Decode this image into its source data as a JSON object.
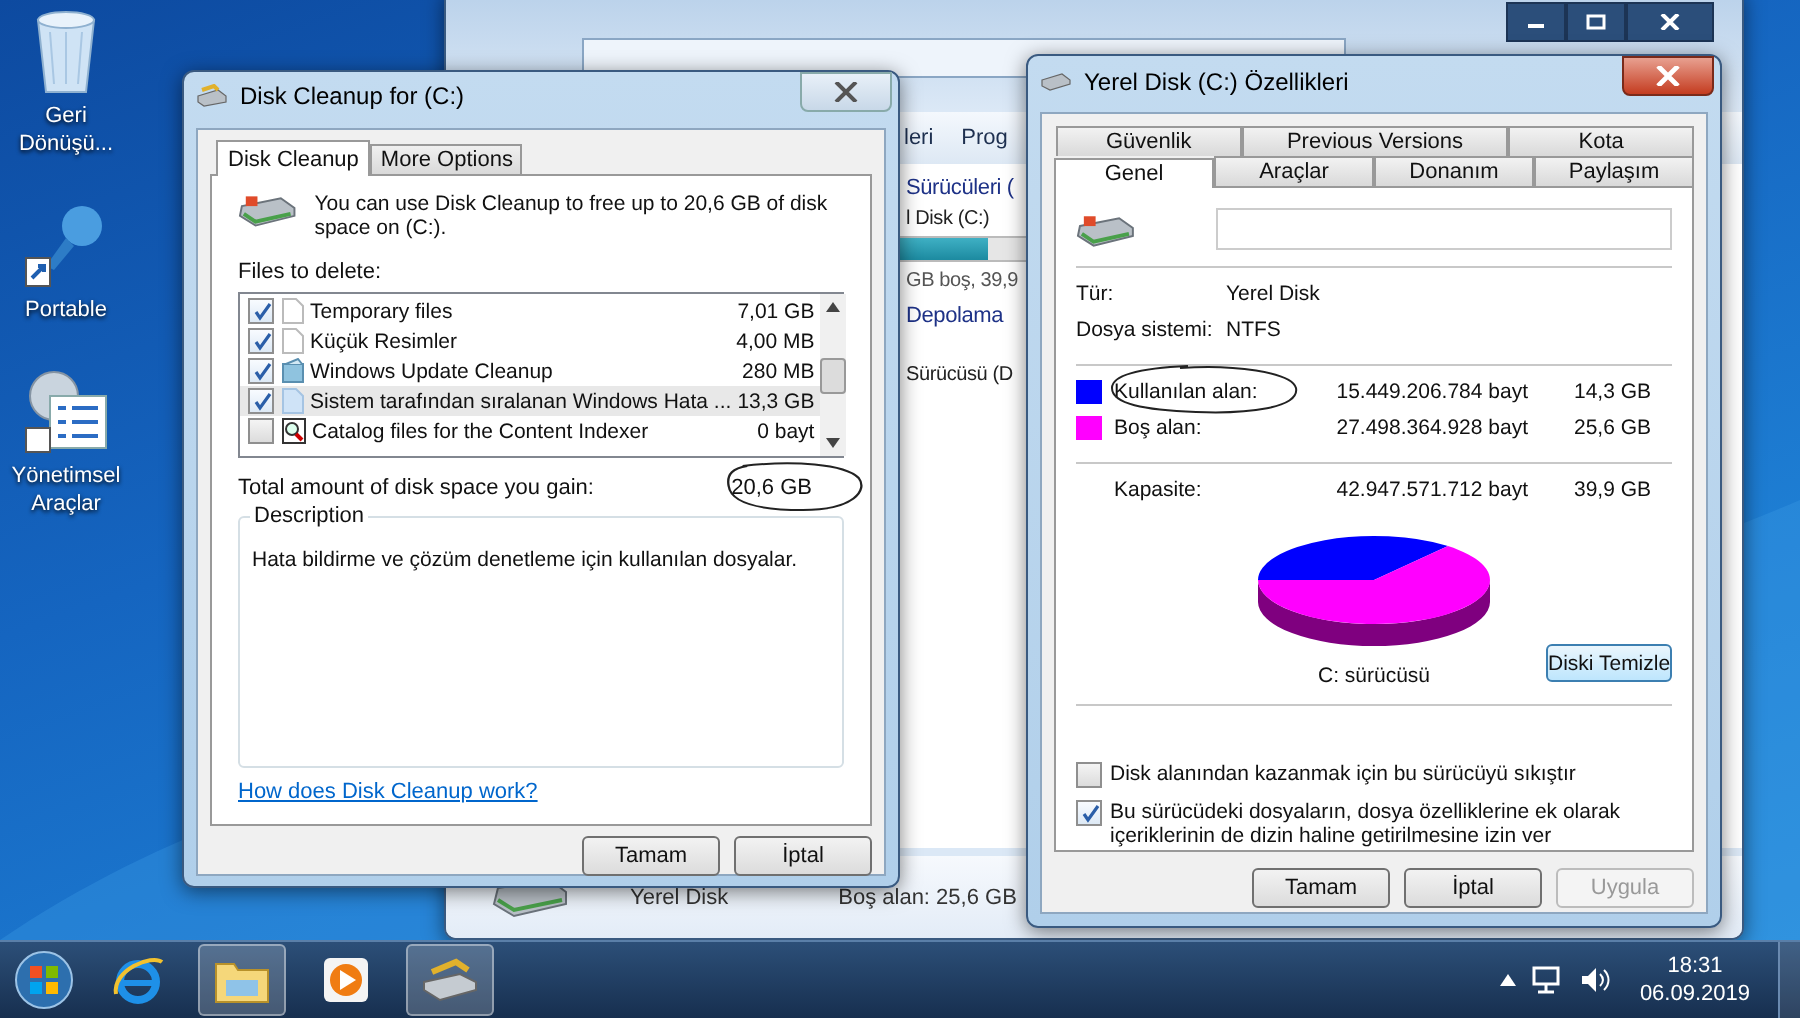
{
  "desktop_icons": [
    {
      "kind": "recycle-bin",
      "label": "Geri Dönüşü..."
    },
    {
      "kind": "pin",
      "label": "Portable"
    },
    {
      "kind": "tools",
      "label": "Yönetimsel Araçlar"
    }
  ],
  "explorer": {
    "toolbar": [
      "leri",
      "Prog"
    ],
    "heading": "Sürücüleri (",
    "drive": "l Disk (C:)",
    "drive_bar": {
      "level": 0.36
    },
    "free_text": "GB boş, 39,9",
    "section": "Depolama",
    "drive2": "Sürücüsü (D",
    "details": {
      "name": "Yerel Disk",
      "free": "Boş alan: 25,6 GB"
    }
  },
  "disk_cleanup": {
    "title": "Disk Cleanup for  (C:)",
    "tabs": [
      {
        "label": "Disk Cleanup",
        "selected": true
      },
      {
        "label": "More Options",
        "selected": false
      }
    ],
    "intro": "You can use Disk Cleanup to free up to 20,6 GB of disk space on (C:).",
    "files_label": "Files to delete:",
    "files": [
      {
        "kind": "file",
        "checked": true,
        "selected": false,
        "label": "Temporary files",
        "size": "7,01 GB"
      },
      {
        "kind": "file",
        "checked": true,
        "selected": false,
        "label": "Küçük Resimler",
        "size": "4,00 MB"
      },
      {
        "kind": "update",
        "checked": true,
        "selected": false,
        "label": "Windows Update Cleanup",
        "size": "280 MB"
      },
      {
        "kind": "report",
        "checked": true,
        "selected": true,
        "label": "Sistem tarafından sıralanan Windows Hata ...",
        "size": "13,3 GB"
      },
      {
        "kind": "catalog",
        "checked": false,
        "selected": false,
        "label": "Catalog files for the Content Indexer",
        "size": "0 bayt"
      }
    ],
    "total_label": "Total amount of disk space you gain:",
    "total": "20,6 GB",
    "description_label": "Description",
    "description": "Hata bildirme ve çözüm denetleme için kullanılan dosyalar.",
    "link": "How does Disk Cleanup work?",
    "buttons": [
      "Tamam",
      "İptal"
    ]
  },
  "properties": {
    "title": "Yerel Disk (C:) Özellikleri",
    "tab_rows": [
      [
        {
          "label": "Güvenlik",
          "selected": false
        },
        {
          "label": "Previous Versions",
          "selected": false
        },
        {
          "label": "Kota",
          "selected": false
        }
      ],
      [
        {
          "label": "Genel",
          "selected": true
        },
        {
          "label": "Araçlar",
          "selected": false
        },
        {
          "label": "Donanım",
          "selected": false
        },
        {
          "label": "Paylaşım",
          "selected": false
        }
      ]
    ],
    "info": [
      {
        "label": "Tür:",
        "value": "Yerel Disk"
      },
      {
        "label": "Dosya sistemi:",
        "value": "NTFS"
      }
    ],
    "usage": [
      {
        "label": "Kullanılan alan:",
        "bytes": "15.449.206.784 bayt",
        "size": "14,3 GB",
        "color": "#0000ff"
      },
      {
        "label": "Boş alan:",
        "bytes": "27.498.364.928 bayt",
        "size": "25,6 GB",
        "color": "#ff00ff"
      }
    ],
    "capacity": {
      "label": "Kapasite:",
      "bytes": "42.947.571.712 bayt",
      "size": "39,9 GB"
    },
    "drive_label": "C: sürücüsü",
    "cleanup_button": "Diski Temizle",
    "options": [
      {
        "label": "Disk alanından kazanmak için bu sürücüyü sıkıştır",
        "checked": false
      },
      {
        "label": "Bu sürücüdeki dosyaların, dosya özelliklerine ek olarak içeriklerinin de dizin haline getirilmesine izin ver",
        "checked": true
      }
    ],
    "buttons": [
      {
        "label": "Tamam",
        "disabled": false
      },
      {
        "label": "İptal",
        "disabled": false
      },
      {
        "label": "Uygula",
        "disabled": true
      }
    ]
  },
  "taskbar": {
    "apps": [
      {
        "kind": "ie",
        "active": false
      },
      {
        "kind": "explorer",
        "active": true
      },
      {
        "kind": "media",
        "active": false
      },
      {
        "kind": "cleanup",
        "active": true
      }
    ],
    "time": "18:31",
    "date": "06.09.2019"
  }
}
